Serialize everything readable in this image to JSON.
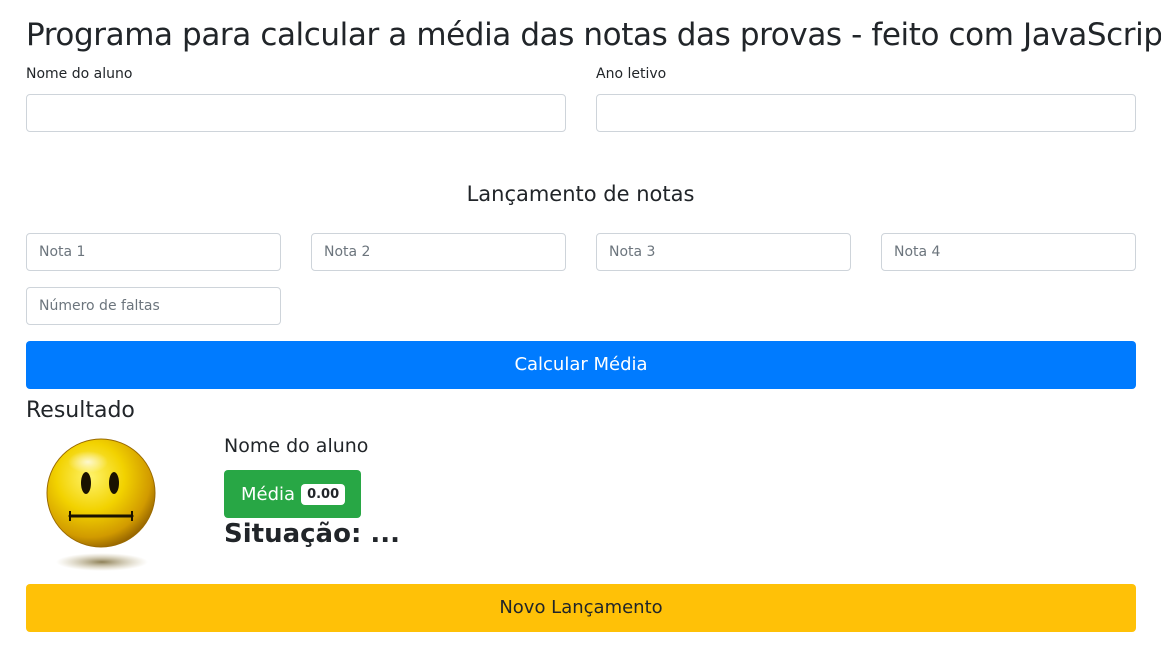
{
  "page": {
    "title": "Programa para calcular a média das notas das provas - feito com JavaScript"
  },
  "student_form": {
    "name_label": "Nome do aluno",
    "name_value": "",
    "year_label": "Ano letivo",
    "year_value": ""
  },
  "grades": {
    "section_title": "Lançamento de notas",
    "nota1_placeholder": "Nota 1",
    "nota2_placeholder": "Nota 2",
    "nota3_placeholder": "Nota 3",
    "nota4_placeholder": "Nota 4",
    "faltas_placeholder": "Número de faltas",
    "calculate_label": "Calcular Média"
  },
  "result": {
    "title": "Resultado",
    "student_name": "Nome do aluno",
    "average_label": "Média",
    "average_value": "0.00",
    "situation": "Situação: ...",
    "emoji_icon": "neutral-face-icon"
  },
  "actions": {
    "new_entry_label": "Novo Lançamento"
  },
  "colors": {
    "primary": "#007bff",
    "success": "#28a745",
    "warning": "#ffc107"
  }
}
